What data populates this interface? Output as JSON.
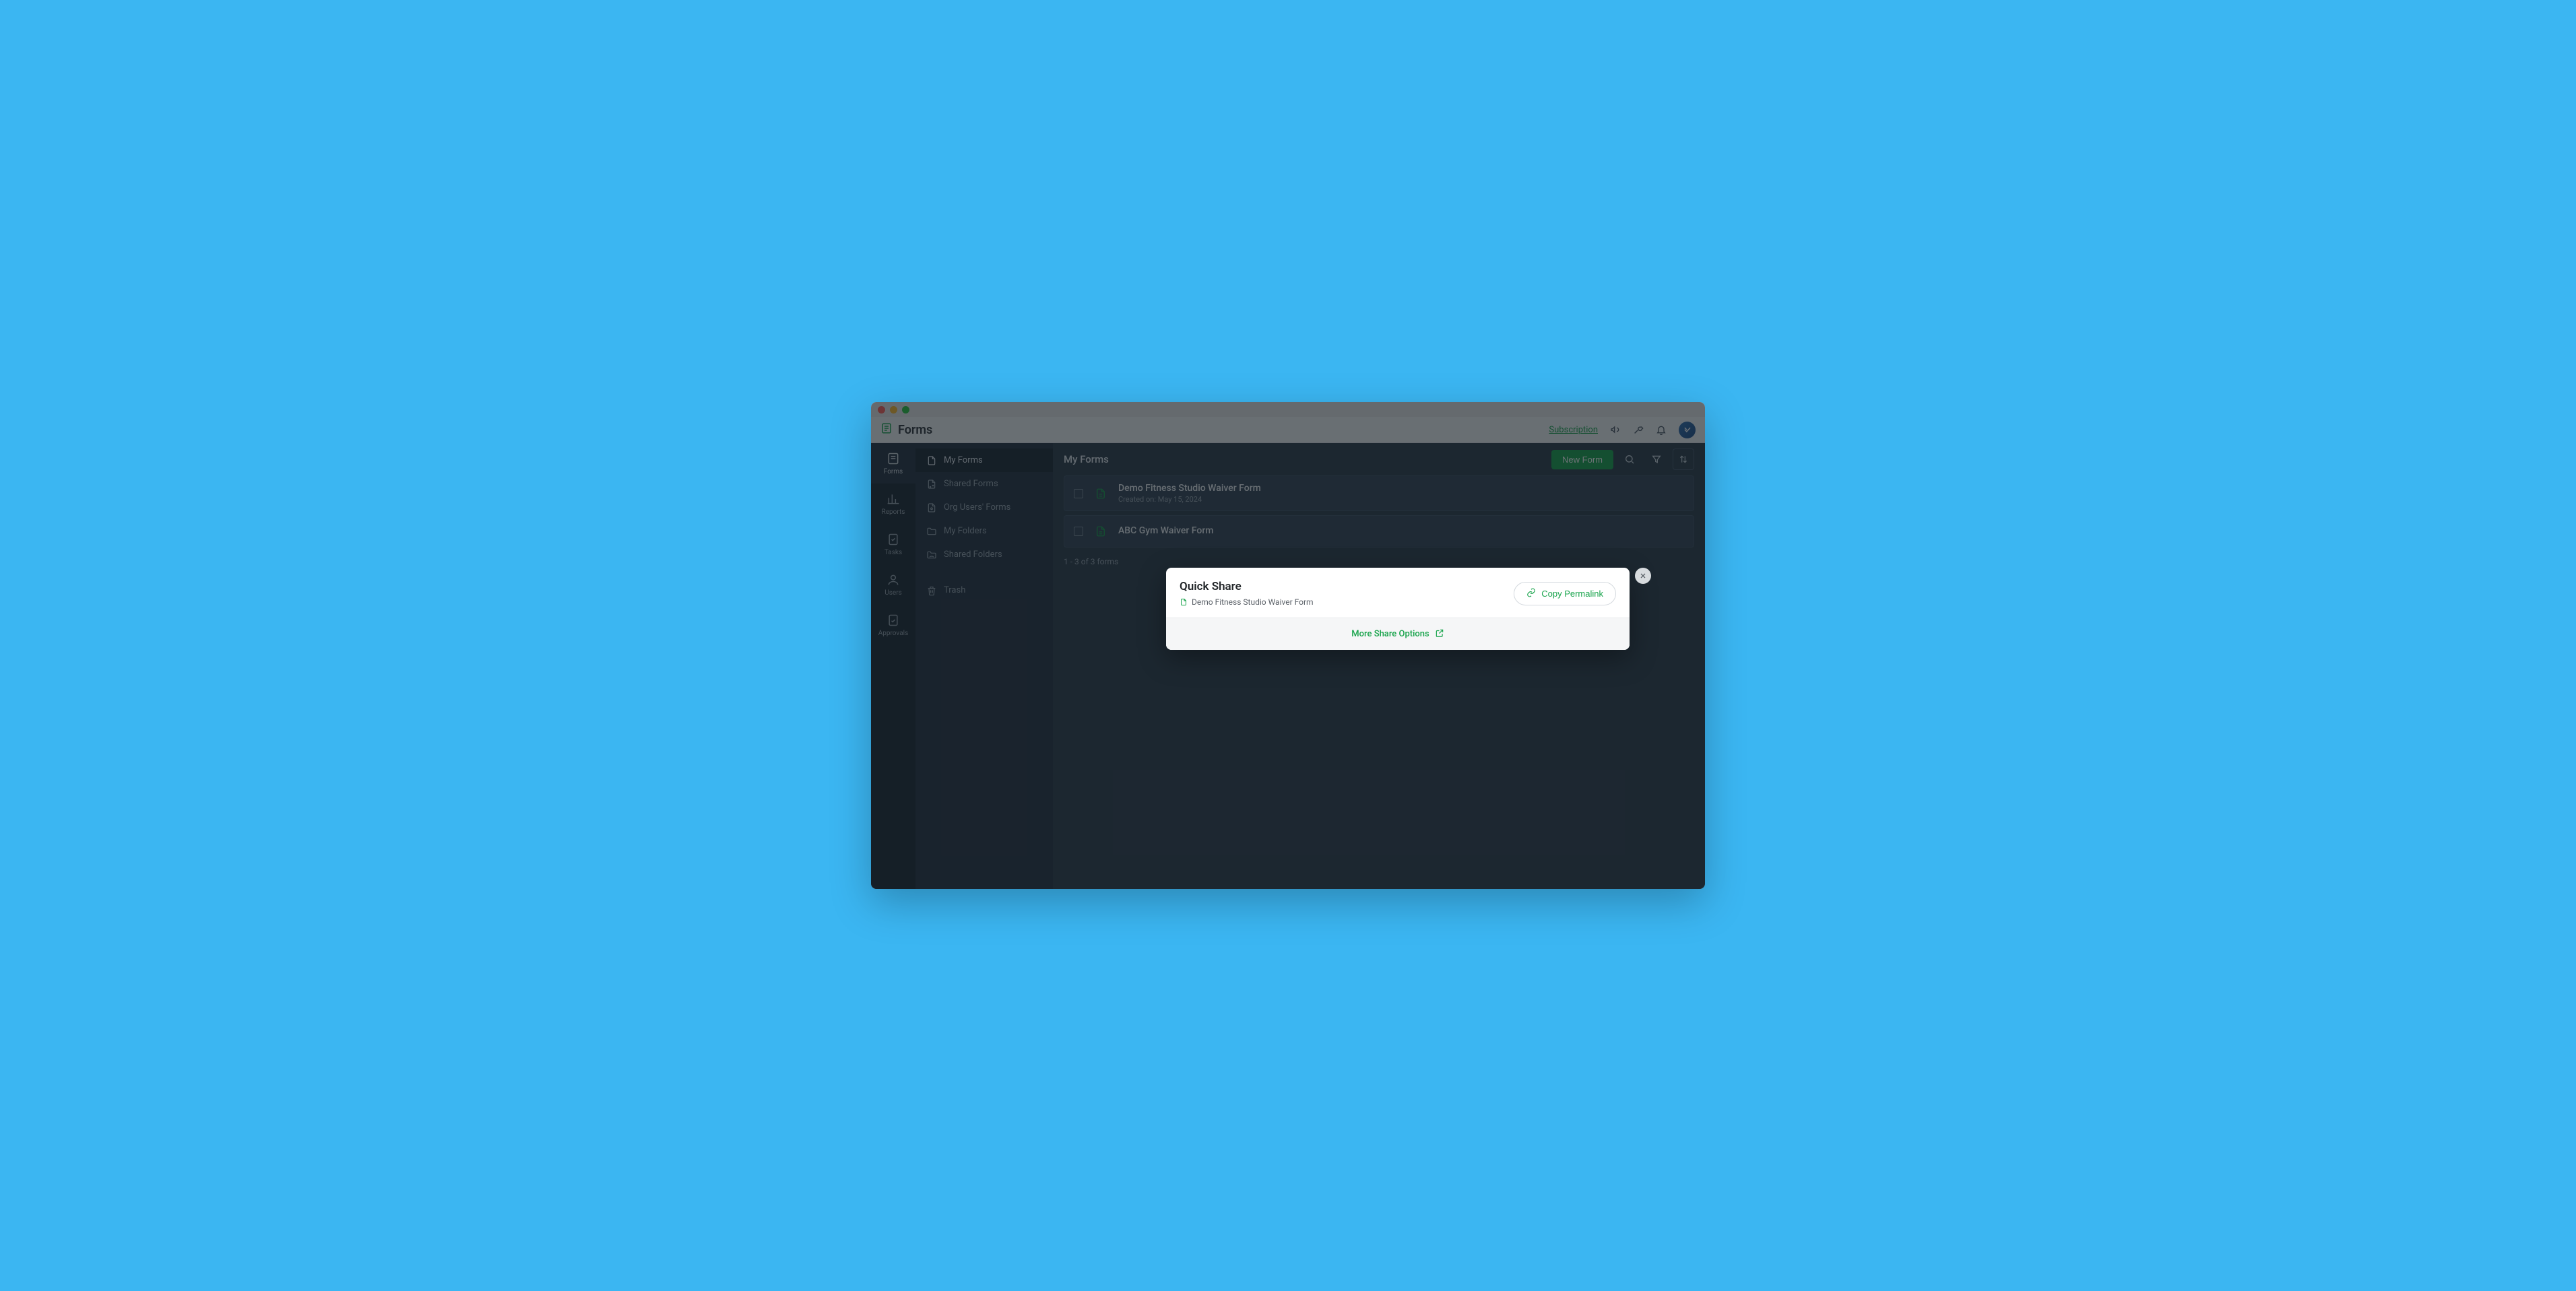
{
  "header": {
    "app_title": "Forms",
    "subscription_label": "Subscription"
  },
  "rail": {
    "items": [
      {
        "label": "Forms"
      },
      {
        "label": "Reports"
      },
      {
        "label": "Tasks"
      },
      {
        "label": "Users"
      },
      {
        "label": "Approvals"
      }
    ]
  },
  "subnav": {
    "items": [
      {
        "label": "My Forms"
      },
      {
        "label": "Shared Forms"
      },
      {
        "label": "Org Users' Forms"
      },
      {
        "label": "My Folders"
      },
      {
        "label": "Shared Folders"
      },
      {
        "label": "Trash"
      }
    ]
  },
  "main": {
    "title": "My Forms",
    "new_form_label": "New Form",
    "rows": [
      {
        "title": "Demo Fitness Studio Waiver Form",
        "sub": "Created on: May 15, 2024"
      },
      {
        "title": "ABC Gym Waiver Form",
        "sub": ""
      }
    ],
    "pager_text": "1 - 3 of 3 forms"
  },
  "modal": {
    "title": "Quick Share",
    "form_name": "Demo Fitness Studio Waiver Form",
    "copy_label": "Copy Permalink",
    "more_label": "More Share Options"
  }
}
